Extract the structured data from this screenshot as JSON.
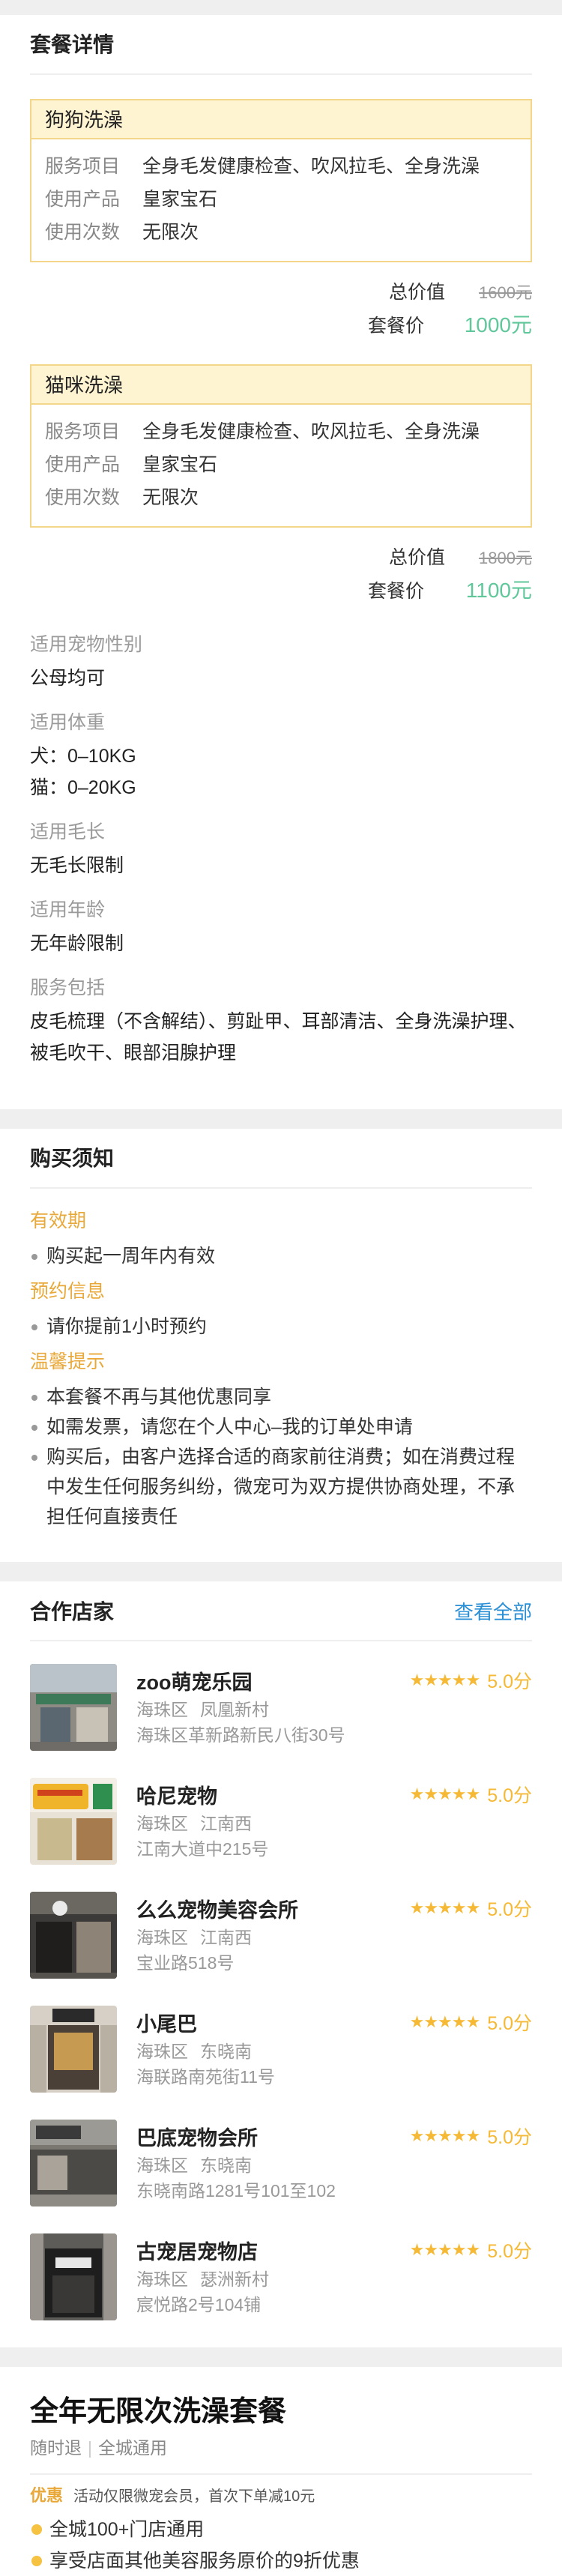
{
  "package_section": {
    "title": "套餐详情",
    "packages": [
      {
        "name": "狗狗洗澡",
        "rows": [
          {
            "k": "服务项目",
            "v": "全身毛发健康检查、吹风拉毛、全身洗澡"
          },
          {
            "k": "使用产品",
            "v": "皇家宝石"
          },
          {
            "k": "使用次数",
            "v": "无限次"
          }
        ],
        "total_label": "总价值",
        "total_value": "1600元",
        "price_label": "套餐价",
        "price_value": "1000元"
      },
      {
        "name": "猫咪洗澡",
        "rows": [
          {
            "k": "服务项目",
            "v": "全身毛发健康检查、吹风拉毛、全身洗澡"
          },
          {
            "k": "使用产品",
            "v": "皇家宝石"
          },
          {
            "k": "使用次数",
            "v": "无限次"
          }
        ],
        "total_label": "总价值",
        "total_value": "1800元",
        "price_label": "套餐价",
        "price_value": "1100元"
      }
    ],
    "attributes": [
      {
        "label": "适用宠物性别",
        "values": [
          "公母均可"
        ]
      },
      {
        "label": "适用体重",
        "values": [
          "犬：0–10KG",
          "猫：0–20KG"
        ]
      },
      {
        "label": "适用毛长",
        "values": [
          "无毛长限制"
        ]
      },
      {
        "label": "适用年龄",
        "values": [
          "无年龄限制"
        ]
      },
      {
        "label": "服务包括",
        "values": [
          "皮毛梳理（不含解结）、剪趾甲、耳部清洁、全身洗澡护理、被毛吹干、眼部泪腺护理"
        ]
      }
    ]
  },
  "notice": {
    "title": "购买须知",
    "groups": [
      {
        "heading": "有效期",
        "items": [
          "购买起一周年内有效"
        ]
      },
      {
        "heading": "预约信息",
        "items": [
          "请你提前1小时预约"
        ]
      },
      {
        "heading": "温馨提示",
        "items": [
          "本套餐不再与其他优惠同享",
          "如需发票，请您在个人中心–我的订单处申请",
          "购买后，由客户选择合适的商家前往消费；如在消费过程中发生任何服务纠纷，微宠可为双方提供协商处理，不承担任何直接责任"
        ]
      }
    ]
  },
  "stores": {
    "title": "合作店家",
    "view_all": "查看全部",
    "stars": "★★★★★",
    "items": [
      {
        "name": "zoo萌宠乐园",
        "district": "海珠区",
        "area": "凤凰新村",
        "address": "海珠区革新路新民八街30号",
        "score": "5.0分"
      },
      {
        "name": "哈尼宠物",
        "district": "海珠区",
        "area": "江南西",
        "address": "江南大道中215号",
        "score": "5.0分"
      },
      {
        "name": "么么宠物美容会所",
        "district": "海珠区",
        "area": "江南西",
        "address": "宝业路518号",
        "score": "5.0分"
      },
      {
        "name": "小尾巴",
        "district": "海珠区",
        "area": "东晓南",
        "address": "海联路南苑街11号",
        "score": "5.0分"
      },
      {
        "name": "巴底宠物会所",
        "district": "海珠区",
        "area": "东晓南",
        "address": "东晓南路1281号101至102",
        "score": "5.0分"
      },
      {
        "name": "古宠居宠物店",
        "district": "海珠区",
        "area": "瑟洲新村",
        "address": "宸悦路2号104铺",
        "score": "5.0分"
      }
    ]
  },
  "product": {
    "title": "全年无限次洗澡套餐",
    "tag1": "随时退",
    "separator": "|",
    "tag2": "全城通用",
    "promo_tag": "优惠",
    "promo_text": "活动仅限微宠会员，首次下单减10元",
    "features": [
      "全城100+门店通用",
      "享受店面其他美容服务原价的9折优惠"
    ]
  },
  "colors": {
    "accent_green": "#5fc79a",
    "accent_orange": "#e8a93a",
    "link_blue": "#2b8fd6",
    "star_yellow": "#f5b936"
  }
}
